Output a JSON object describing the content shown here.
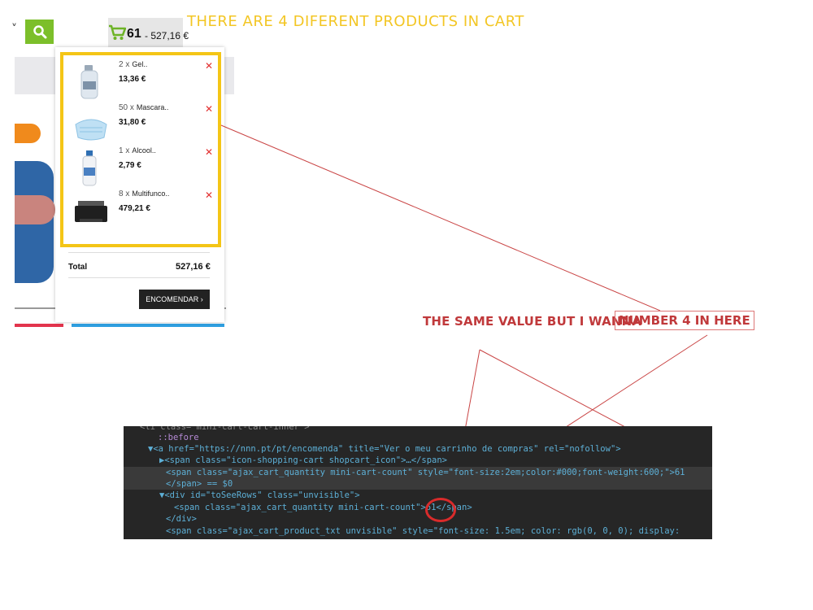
{
  "header": {
    "chevron": "˅",
    "cart_count": "61",
    "cart_total": "- 527,16 €"
  },
  "annotations": {
    "top": "THERE ARE 4 DIFERENT PRODUCTS IN CART",
    "mid": "THE SAME VALUE BUT I WANNA",
    "mid_boxed": "NUMBER 4 IN HERE"
  },
  "cart": {
    "items": [
      {
        "qty": "2 x",
        "name": "Gel..",
        "price": "13,36 €",
        "icon": "bottle-icon"
      },
      {
        "qty": "50 x",
        "name": "Mascara..",
        "price": "31,80 €",
        "icon": "mask-icon"
      },
      {
        "qty": "1 x",
        "name": "Alcool..",
        "price": "2,79 €",
        "icon": "bottle-icon"
      },
      {
        "qty": "8 x",
        "name": "Multifunco..",
        "price": "479,21 €",
        "icon": "printer-icon"
      }
    ],
    "remove_symbol": "✕",
    "total_label": "Total",
    "total_value": "527,16 €",
    "order_button": "ENCOMENDAR ›"
  },
  "devtools": {
    "lines": [
      "<li class=\"mini-cart-cart-inner\">",
      "::before",
      "▼<a href=\"https://nnn.pt/pt/encomenda\" title=\"Ver o meu carrinho de compras\" rel=\"nofollow\">",
      "▶<span class=\"icon-shopping-cart shopcart_icon\">…</span>",
      "<span class=\"ajax_cart_quantity mini-cart-count\" style=\"font-size:2em;color:#000;font-weight:600;\">61",
      "</span> == $0",
      "▼<div id=\"toSeeRows\" class=\"unvisible\">",
      "<span class=\"ajax_cart_quantity mini-cart-count\">61</span>",
      "</div>",
      "<span class=\"ajax_cart_product_txt unvisible\" style=\"font-size: 1.5em; color: rgb(0, 0, 0); display:"
    ]
  }
}
